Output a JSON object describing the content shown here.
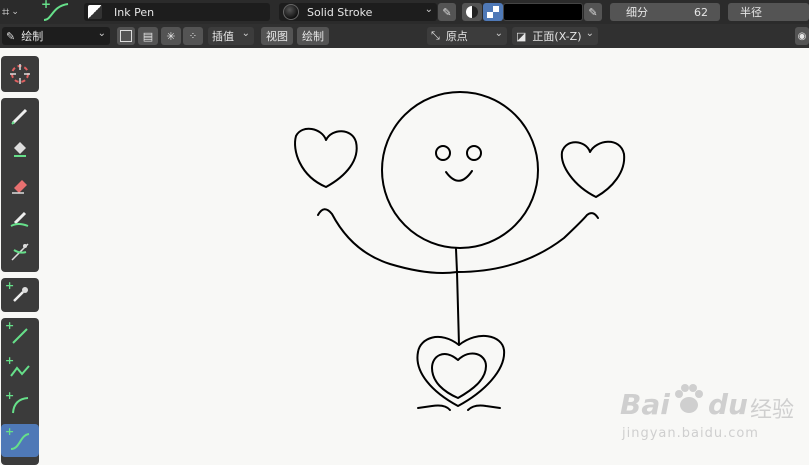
{
  "topbar": {
    "brush_name": "Ink Pen",
    "material_name": "Solid Stroke",
    "subdivide_label": "细分",
    "subdivide_value": "62",
    "radius_label": "半径"
  },
  "toolbar2": {
    "mode": "绘制",
    "interpolate_label": "插值",
    "view_menu": "视图",
    "draw_menu": "绘制",
    "origin_select": "原点",
    "plane_select": "正面(X-Z)"
  },
  "colors": {
    "header_bg": "#2b2b2b",
    "canvas_bg": "#f8f8f6",
    "active_tool": "#4f79b7",
    "accent_green": "#66e08a",
    "stroke_color": "#000000"
  },
  "tools": [
    {
      "name": "cursor-tool"
    },
    {
      "name": "draw-tool"
    },
    {
      "name": "fill-tool"
    },
    {
      "name": "erase-tool"
    },
    {
      "name": "tint-tool"
    },
    {
      "name": "cutter-tool"
    },
    {
      "name": "eyedropper-tool"
    },
    {
      "name": "line-tool"
    },
    {
      "name": "polyline-tool"
    },
    {
      "name": "arc-tool"
    },
    {
      "name": "curve-tool"
    }
  ],
  "watermark": {
    "brand_a": "Bai",
    "brand_b": "du",
    "brand_cn": "经验",
    "url": "jingyan.baidu.com"
  }
}
